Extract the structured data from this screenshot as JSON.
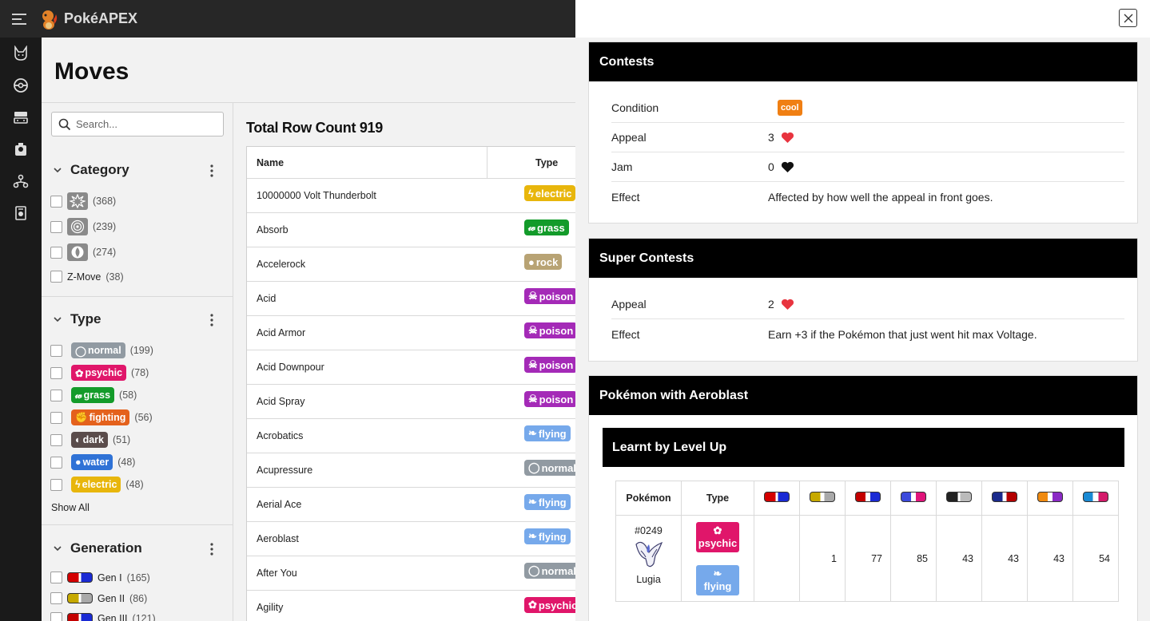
{
  "app": {
    "name": "PokéAPEX"
  },
  "page": {
    "title": "Moves"
  },
  "search": {
    "placeholder": "Search..."
  },
  "filters": {
    "category": {
      "title": "Category",
      "options": [
        {
          "icon": "physical-icon",
          "count": "(368)"
        },
        {
          "icon": "special-icon",
          "count": "(239)"
        },
        {
          "icon": "status-icon",
          "count": "(274)"
        },
        {
          "label": "Z-Move",
          "count": "(38)"
        }
      ]
    },
    "type": {
      "title": "Type",
      "options": [
        {
          "label": "normal",
          "count": "(199)",
          "color": "#919aa2"
        },
        {
          "label": "psychic",
          "count": "(78)",
          "color": "#e0166a"
        },
        {
          "label": "grass",
          "count": "(58)",
          "color": "#139b2a"
        },
        {
          "label": "fighting",
          "count": "(56)",
          "color": "#e4611c"
        },
        {
          "label": "dark",
          "count": "(51)",
          "color": "#5a4c4b"
        },
        {
          "label": "water",
          "count": "(48)",
          "color": "#2f72d6"
        },
        {
          "label": "electric",
          "count": "(48)",
          "color": "#e8b60c"
        }
      ],
      "show_all": "Show All"
    },
    "generation": {
      "title": "Generation",
      "options": [
        {
          "label": "Gen I",
          "count": "(165)"
        },
        {
          "label": "Gen II",
          "count": "(86)"
        },
        {
          "label": "Gen III",
          "count": "(121)"
        }
      ]
    }
  },
  "table": {
    "total": "Total Row Count 919",
    "headers": {
      "name": "Name",
      "type": "Type"
    },
    "rows": [
      {
        "name": "10000000 Volt Thunderbolt",
        "type": "electric",
        "color": "#e8b60c"
      },
      {
        "name": "Absorb",
        "type": "grass",
        "color": "#139b2a"
      },
      {
        "name": "Accelerock",
        "type": "rock",
        "color": "#b8a374"
      },
      {
        "name": "Acid",
        "type": "poison",
        "color": "#a42ab7"
      },
      {
        "name": "Acid Armor",
        "type": "poison",
        "color": "#a42ab7"
      },
      {
        "name": "Acid Downpour",
        "type": "poison",
        "color": "#a42ab7"
      },
      {
        "name": "Acid Spray",
        "type": "poison",
        "color": "#a42ab7"
      },
      {
        "name": "Acrobatics",
        "type": "flying",
        "color": "#76a9eb"
      },
      {
        "name": "Acupressure",
        "type": "normal",
        "color": "#919aa2"
      },
      {
        "name": "Aerial Ace",
        "type": "flying",
        "color": "#76a9eb"
      },
      {
        "name": "Aeroblast",
        "type": "flying",
        "color": "#76a9eb"
      },
      {
        "name": "After You",
        "type": "normal",
        "color": "#919aa2"
      },
      {
        "name": "Agility",
        "type": "psychic",
        "color": "#e0166a"
      }
    ]
  },
  "drawer": {
    "contests": {
      "title": "Contests",
      "condition_label": "Condition",
      "condition_value": "cool",
      "appeal_label": "Appeal",
      "appeal_value": "3",
      "jam_label": "Jam",
      "jam_value": "0",
      "effect_label": "Effect",
      "effect_value": "Affected by how well the appeal in front goes."
    },
    "super_contests": {
      "title": "Super Contests",
      "appeal_label": "Appeal",
      "appeal_value": "2",
      "effect_label": "Effect",
      "effect_value": "Earn +3 if the Pokémon that just went hit max Voltage."
    },
    "pokemon": {
      "title": "Pokémon with Aeroblast",
      "level_up": {
        "title": "Learnt by Level Up",
        "headers": {
          "pokemon": "Pokémon",
          "type": "Type"
        },
        "generations": [
          "I",
          "II",
          "III",
          "IV",
          "V",
          "VI",
          "VII",
          "VIII"
        ],
        "rows": [
          {
            "number": "#0249",
            "name": "Lugia",
            "types": [
              {
                "label": "psychic",
                "color": "#e0166a"
              },
              {
                "label": "flying",
                "color": "#76a9eb"
              }
            ],
            "levels": [
              "",
              "1",
              "77",
              "85",
              "43",
              "43",
              "43",
              "54"
            ]
          }
        ]
      }
    }
  }
}
